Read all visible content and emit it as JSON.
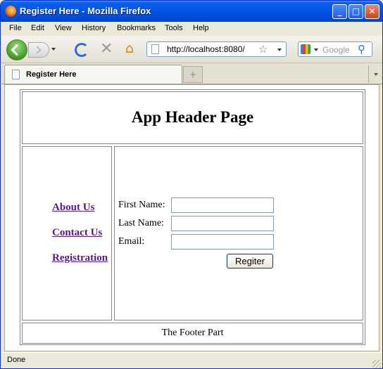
{
  "window": {
    "title": "Register Here - Mozilla Firefox"
  },
  "menu": [
    "File",
    "Edit",
    "View",
    "History",
    "Bookmarks",
    "Tools",
    "Help"
  ],
  "nav": {
    "url": "http://localhost:8080/",
    "search_placeholder": "Google"
  },
  "tab": {
    "label": "Register Here",
    "new_tab_icon": "+"
  },
  "page": {
    "header": "App Header Page",
    "links": [
      "About Us",
      "Contact Us",
      "Registration"
    ],
    "form": {
      "first_name_label": "First Name:",
      "last_name_label": "Last Name:",
      "email_label": "Email:",
      "first_name_value": "",
      "last_name_value": "",
      "email_value": "",
      "submit_label": "Regiter"
    },
    "footer": "The Footer Part"
  },
  "status": {
    "text": "Done"
  },
  "colors": {
    "title_bar": "#0055e5",
    "visited_link": "#551a8b",
    "content_bg": "#ffffff",
    "chrome_bg": "#ece9d8"
  }
}
